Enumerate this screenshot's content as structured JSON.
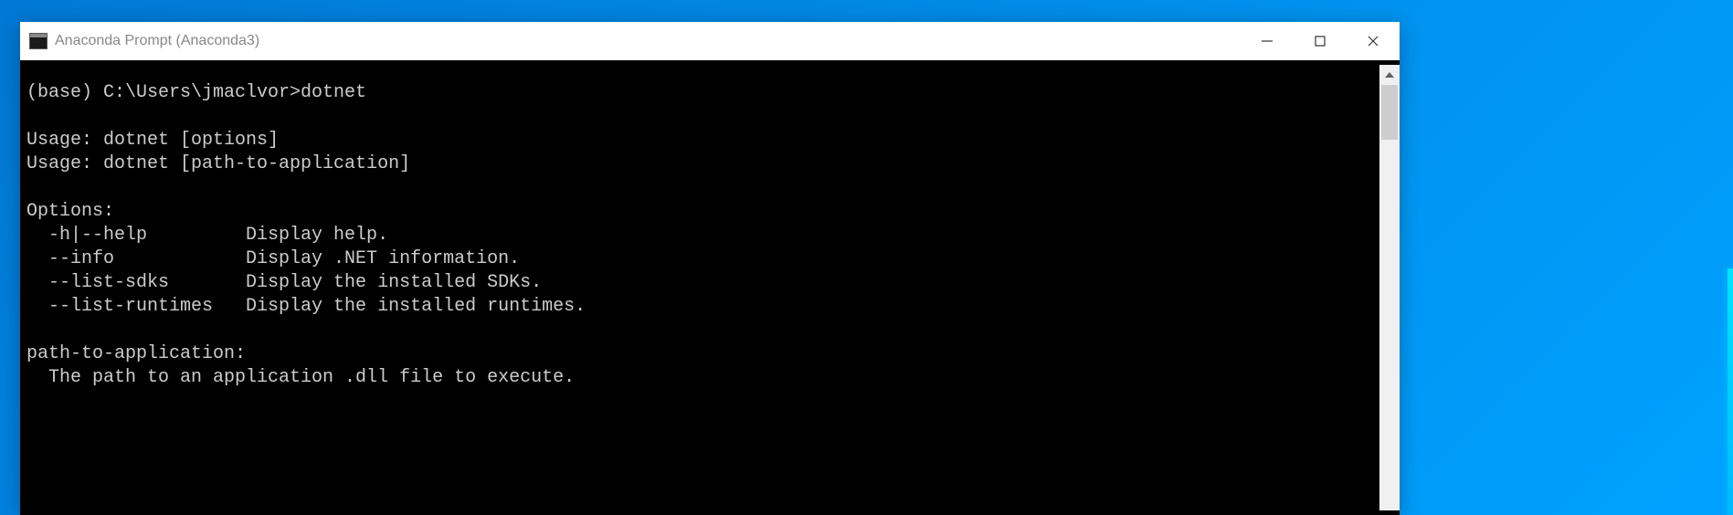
{
  "window": {
    "title": "Anaconda Prompt (Anaconda3)"
  },
  "terminal": {
    "prompt_line": "(base) C:\\Users\\jmaclvor>dotnet",
    "usage1": "Usage: dotnet [options]",
    "usage2": "Usage: dotnet [path-to-application]",
    "options_header": "Options:",
    "opt1": "  -h|--help         Display help.",
    "opt2": "  --info            Display .NET information.",
    "opt3": "  --list-sdks       Display the installed SDKs.",
    "opt4": "  --list-runtimes   Display the installed runtimes.",
    "path_header": "path-to-application:",
    "path_desc": "  The path to an application .dll file to execute."
  }
}
